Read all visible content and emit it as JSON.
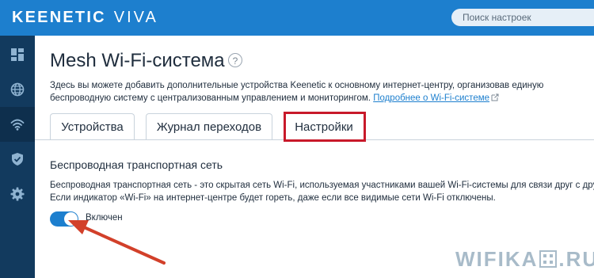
{
  "header": {
    "brand": "KEENETIC",
    "model": "VIVA",
    "search_placeholder": "Поиск настроек",
    "background_color": "#1d7fce"
  },
  "sidebar": {
    "items": [
      {
        "icon": "dashboard-icon"
      },
      {
        "icon": "globe-icon"
      },
      {
        "icon": "wifi-icon",
        "active": true
      },
      {
        "icon": "shield-check-icon"
      },
      {
        "icon": "gear-icon"
      }
    ],
    "background_color": "#123a5e"
  },
  "page": {
    "title": "Mesh Wi-Fi-система",
    "help_label": "?",
    "description": "Здесь вы можете добавить дополнительные устройства Keenetic к основному интернет-центру, организовав единую беспроводную систему с централизованным управлением и мониторингом.",
    "more_link": "Подробнее о Wi-Fi-системе"
  },
  "tabs": [
    {
      "label": "Устройства"
    },
    {
      "label": "Журнал переходов"
    },
    {
      "label": "Настройки",
      "active": true
    }
  ],
  "section": {
    "title": "Беспроводная транспортная сеть",
    "description": "Беспроводная транспортная сеть - это скрытая сеть Wi-Fi, используемая участниками вашей Wi-Fi-системы для связи друг с другом. Если индикатор «Wi-Fi» на интернет-центре будет гореть, даже если все видимые сети Wi-Fi отключены.",
    "toggle_label": "Включен",
    "toggle_on": true
  },
  "watermark": {
    "text_left": "WIFIKA",
    "text_right": ".RU"
  },
  "colors": {
    "accent": "#1d7fce",
    "highlight": "#c8192a",
    "annotation_arrow": "#d2402a"
  }
}
